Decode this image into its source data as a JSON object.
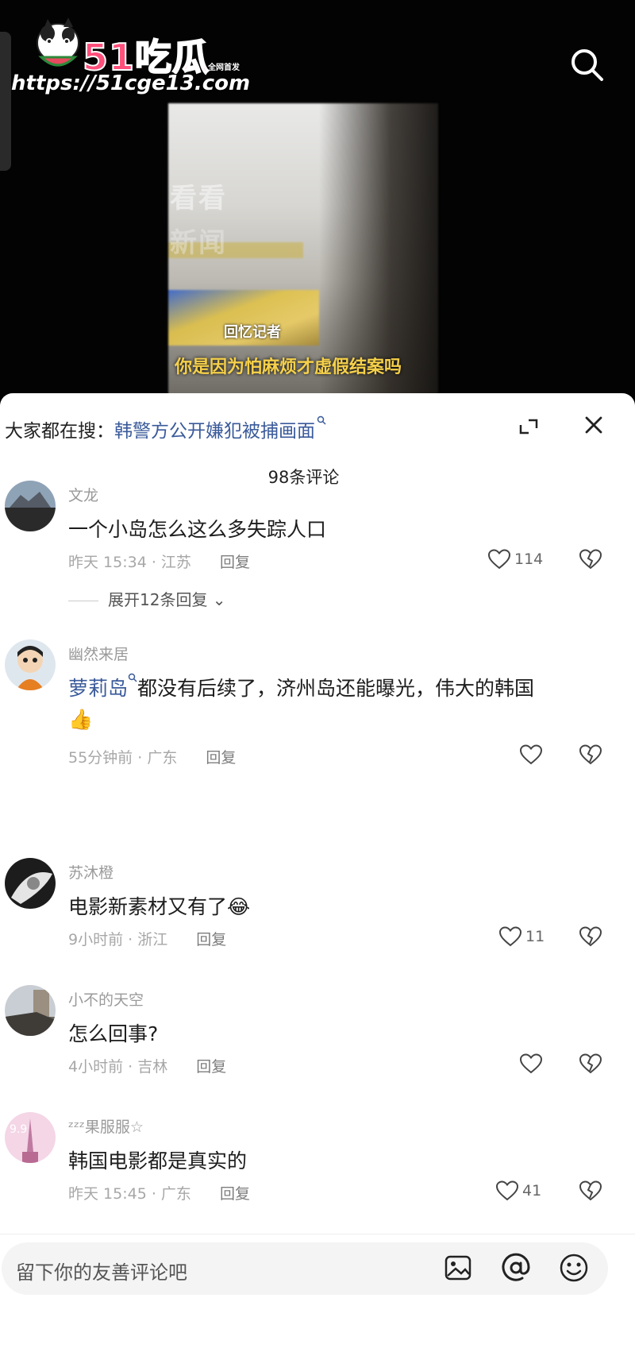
{
  "watermark": {
    "brand": "51吃瓜",
    "brand_sub": "全网首发",
    "url": "https://51cge13.com"
  },
  "video": {
    "overlay_text_1": "看看",
    "overlay_text_2": "新闻",
    "subtitle": "回忆记者",
    "caption": "你是因为怕麻烦才虚假结案吗"
  },
  "sheet": {
    "search_prefix": "大家都在搜：",
    "search_term": "韩警方公开嫌犯被捕画面",
    "comment_count": "98条评论"
  },
  "comments": [
    {
      "username": "文龙",
      "mention": "",
      "text": "一个小岛怎么这么多失踪人口",
      "text_line2": "",
      "time": "昨天 15:34",
      "location": "江苏",
      "reply_label": "回复",
      "likes": "114",
      "expand_replies": "展开12条回复"
    },
    {
      "username": "幽然来居",
      "mention": "萝莉岛",
      "text": "都没有后续了，济州岛还能曝光，伟大的韩国",
      "text_line2": "👍",
      "time": "55分钟前",
      "location": "广东",
      "reply_label": "回复",
      "likes": "",
      "expand_replies": ""
    },
    {
      "username": "苏沐橙",
      "mention": "",
      "text": "电影新素材又有了😂",
      "text_line2": "",
      "time": "9小时前",
      "location": "浙江",
      "reply_label": "回复",
      "likes": "11",
      "expand_replies": ""
    },
    {
      "username": "小不的天空",
      "mention": "",
      "text": "怎么回事?",
      "text_line2": "",
      "time": "4小时前",
      "location": "吉林",
      "reply_label": "回复",
      "likes": "",
      "expand_replies": ""
    },
    {
      "username": "ᶻᶻᶻ果服服☆",
      "mention": "",
      "text": "韩国电影都是真实的",
      "text_line2": "",
      "time": "昨天 15:45",
      "location": "广东",
      "reply_label": "回复",
      "likes": "41",
      "expand_replies": ""
    }
  ],
  "input": {
    "placeholder": "留下你的友善评论吧"
  },
  "colors": {
    "link_blue": "#3a5a9a",
    "brand_pink": "#ff4f7b"
  },
  "icons": [
    "search-icon",
    "expand-icon",
    "close-icon",
    "heart-icon",
    "dislike-icon",
    "image-icon",
    "at-icon",
    "emoji-icon"
  ]
}
